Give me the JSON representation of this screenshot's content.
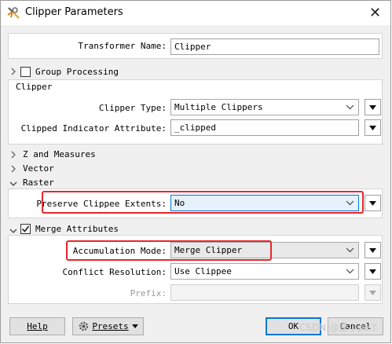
{
  "window": {
    "title": "Clipper Parameters",
    "close_icon": "close-icon",
    "app_icon": "transformer-icon"
  },
  "transformer_name": {
    "label": "Transformer Name:",
    "value": "Clipper"
  },
  "group_processing": {
    "label": "Group Processing",
    "checked": false
  },
  "clipper_section": {
    "title": "Clipper",
    "clipper_type": {
      "label": "Clipper Type:",
      "value": "Multiple Clippers"
    },
    "clipped_indicator": {
      "label": "Clipped Indicator Attribute:",
      "value": "_clipped"
    }
  },
  "collapsed_sections": {
    "z_measures": "Z and Measures",
    "vector": "Vector"
  },
  "raster_section": {
    "title": "Raster",
    "preserve_extents": {
      "label": "Preserve Clippee Extents:",
      "value": "No"
    }
  },
  "merge_section": {
    "title": "Merge Attributes",
    "checked": true,
    "accumulation_mode": {
      "label": "Accumulation Mode:",
      "value": "Merge Clipper"
    },
    "conflict_resolution": {
      "label": "Conflict Resolution:",
      "value": "Use Clippee"
    },
    "prefix": {
      "label": "Prefix:",
      "value": ""
    }
  },
  "buttons": {
    "help": "Help",
    "presets": "Presets",
    "ok": "OK",
    "cancel": "Cancel"
  },
  "watermark": "CSDN @是小pa丫",
  "colors": {
    "highlight_border": "#e8262b",
    "focus_blue": "#0078d7"
  }
}
